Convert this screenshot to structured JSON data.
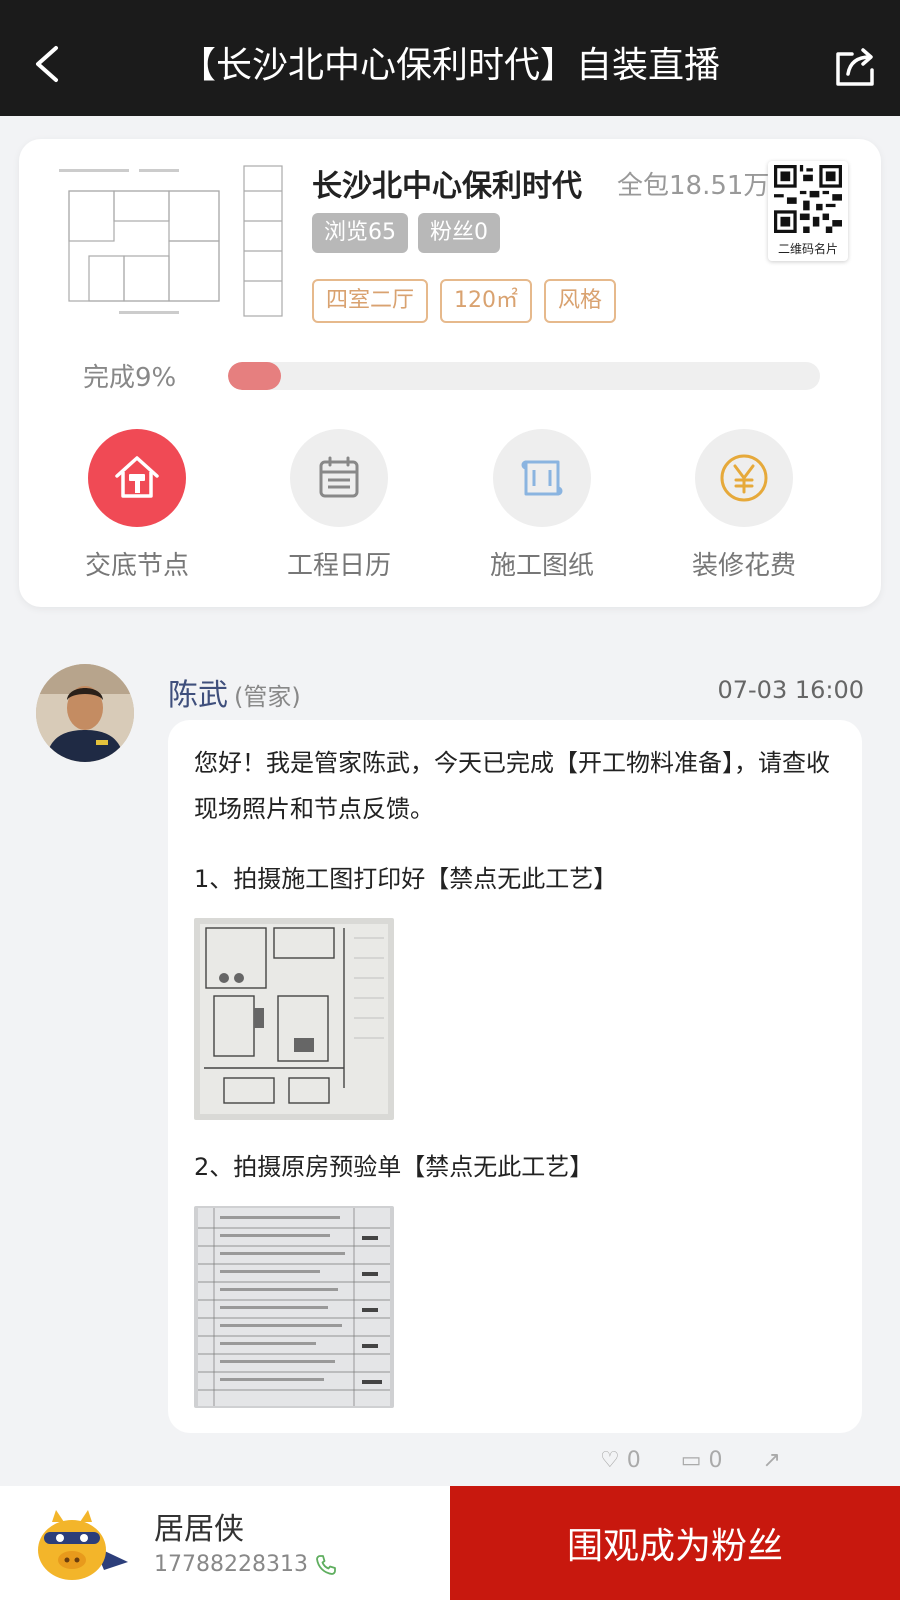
{
  "header": {
    "title": "【长沙北中心保利时代】自装直播",
    "back_icon": "chevron-left-icon",
    "share_icon": "share-icon"
  },
  "project": {
    "name": "长沙北中心保利时代",
    "price": "全包18.51万",
    "views": "浏览65",
    "fans": "粉丝0",
    "tags": [
      "四室二厅",
      "120㎡",
      "风格"
    ],
    "qr_label": "二维码名片",
    "progress_label": "完成9%",
    "progress_percent": 9
  },
  "actions": [
    {
      "label": "交底节点",
      "icon": "house-hammer-icon",
      "active": true
    },
    {
      "label": "工程日历",
      "icon": "calendar-icon",
      "active": false
    },
    {
      "label": "施工图纸",
      "icon": "blueprint-icon",
      "active": false
    },
    {
      "label": "装修花费",
      "icon": "yuan-icon",
      "active": false
    }
  ],
  "post": {
    "author": "陈武",
    "role": "(管家)",
    "time": "07-03 16:00",
    "intro": "您好！我是管家陈武，今天已完成【开工物料准备】，请查收现场照片和节点反馈。",
    "steps": [
      "1、拍摄施工图打印好【禁点无此工艺】",
      "2、拍摄原房预验单【禁点无此工艺】"
    ],
    "reactions": [
      "0",
      "0"
    ]
  },
  "footer": {
    "brand": "居居侠",
    "phone": "17788228313",
    "cta": "围观成为粉丝"
  },
  "colors": {
    "topbar": "#1b1b1b",
    "accent_red": "#f04a55",
    "cta_red": "#c8180e",
    "tag_orange": "#d9a270",
    "author_blue": "#3f4f7c",
    "progress_fill": "#e67f7f"
  }
}
